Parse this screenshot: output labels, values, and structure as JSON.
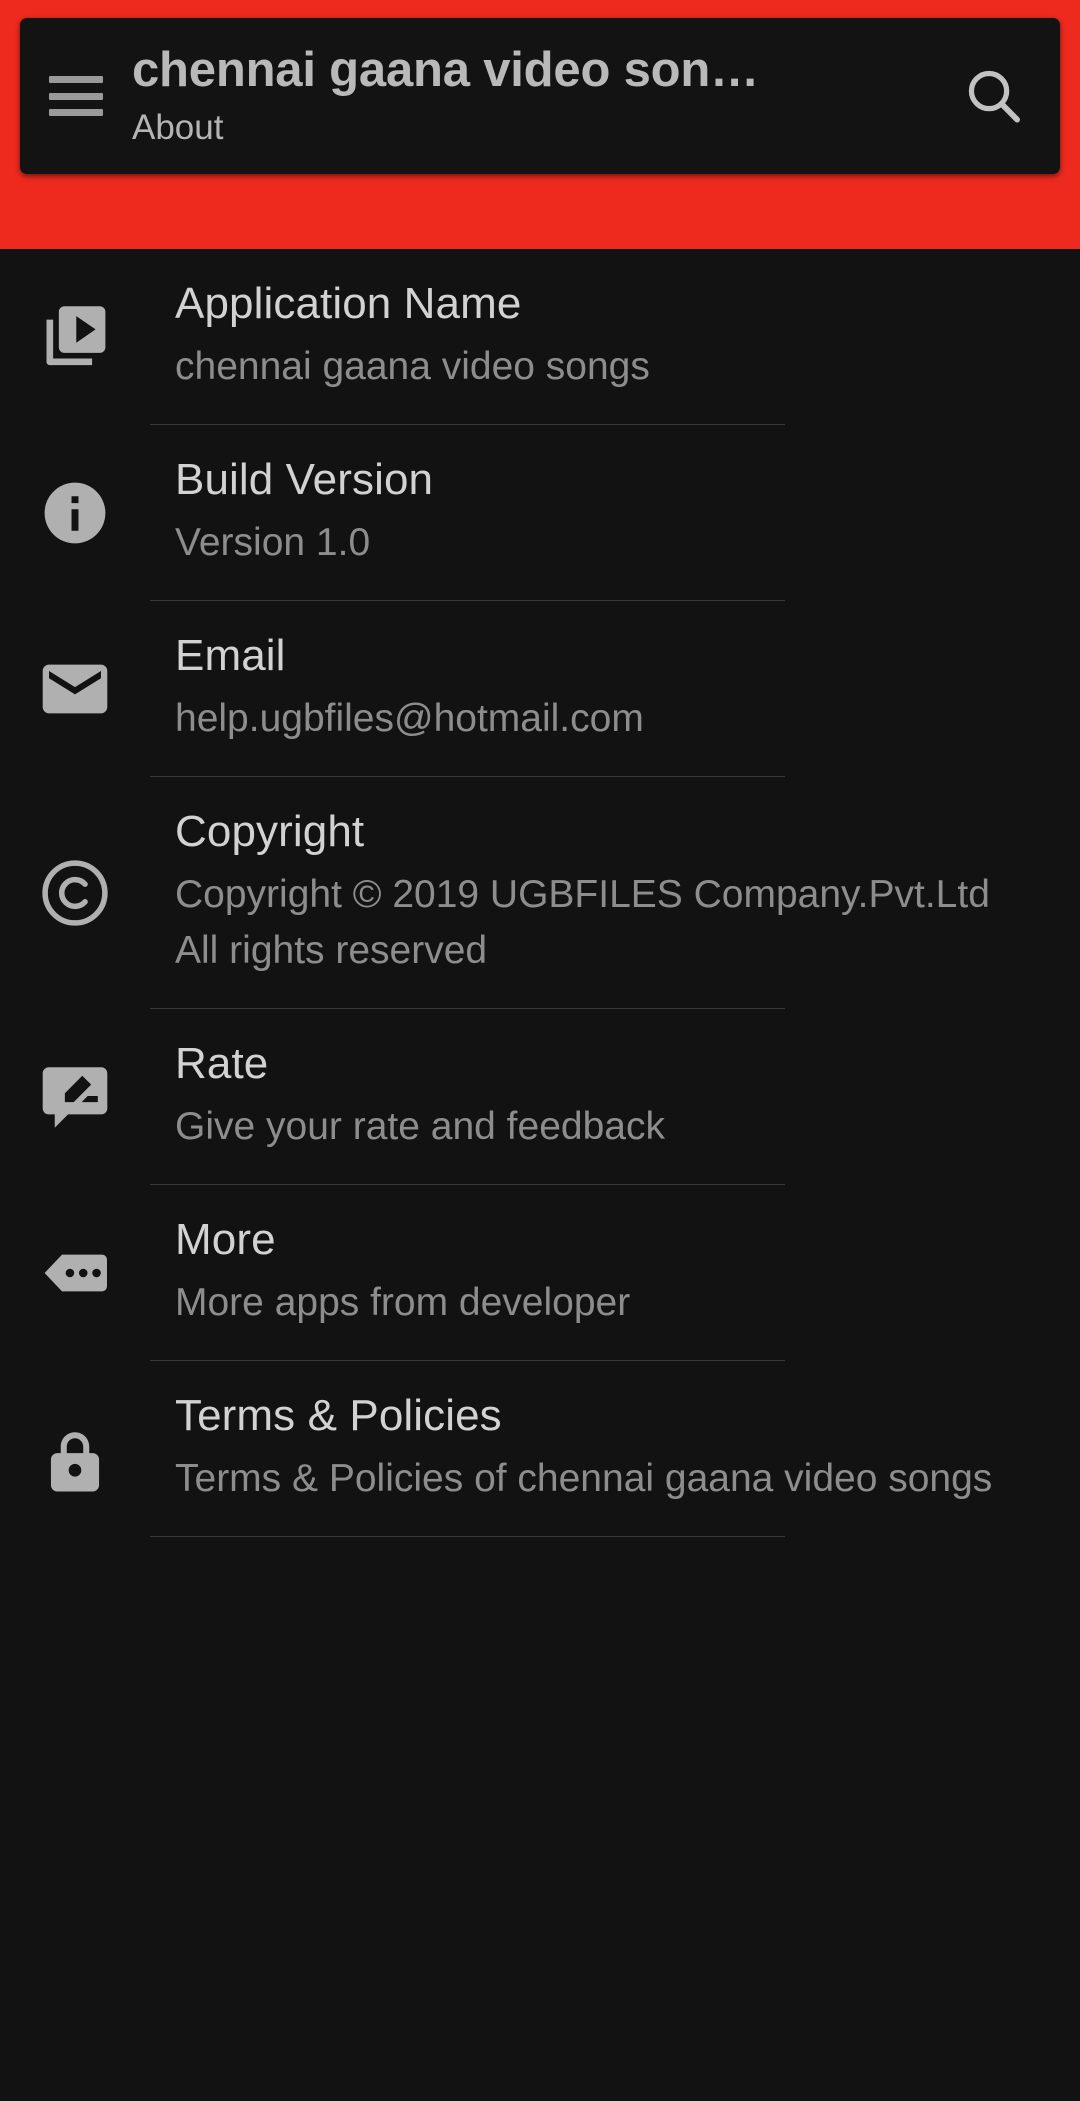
{
  "appbar": {
    "menu_icon": "hamburger-menu-icon",
    "title": "chennai gaana video son…",
    "subtitle": "About",
    "search_icon": "search-icon",
    "band_color": "#EE2A1F",
    "card_color": "#131313"
  },
  "theme": {
    "background": "#121212",
    "accent": "#EE2A1F",
    "title_color": "#d2d2d2",
    "subtitle_color": "#8d8d8d",
    "icon_color": "#b0b0b0",
    "divider_color": "#3a3a3a"
  },
  "list": {
    "items": [
      {
        "icon": "video-library-icon",
        "title": "Application Name",
        "subtitle": "chennai gaana video songs"
      },
      {
        "icon": "info-circle-icon",
        "title": "Build Version",
        "subtitle": "Version 1.0"
      },
      {
        "icon": "email-icon",
        "title": "Email",
        "subtitle": "help.ugbfiles@hotmail.com"
      },
      {
        "icon": "copyright-icon",
        "title": "Copyright",
        "subtitle": "Copyright © 2019 UGBFILES Company.Pvt.Ltd\n All rights reserved"
      },
      {
        "icon": "feedback-pencil-icon",
        "title": "Rate",
        "subtitle": "Give your rate and feedback"
      },
      {
        "icon": "more-dots-icon",
        "title": "More",
        "subtitle": "More apps from developer"
      },
      {
        "icon": "lock-icon",
        "title": "Terms & Policies",
        "subtitle": "Terms & Policies of chennai gaana video songs"
      }
    ]
  }
}
